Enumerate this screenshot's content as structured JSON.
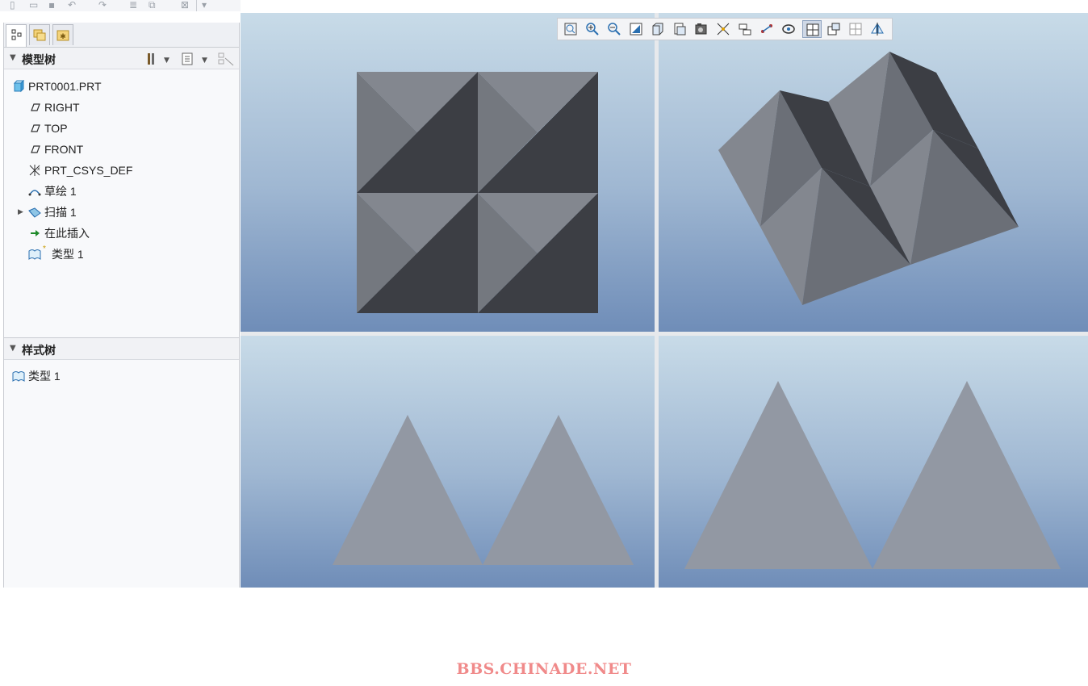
{
  "quick_access": {
    "icons": [
      "new-icon",
      "open-icon",
      "save-icon",
      "undo-icon",
      "redo-icon",
      "regenerate-icon",
      "windows-icon",
      "close-window-icon",
      "customize-icon"
    ]
  },
  "panel": {
    "tabs": [
      {
        "name": "model-tree-tab",
        "active": true
      },
      {
        "name": "folder-browser-tab",
        "active": false
      },
      {
        "name": "favorites-tab",
        "active": false
      }
    ],
    "model_tree": {
      "title": "模型树",
      "items": [
        {
          "label": "PRT0001.PRT",
          "icon": "part-icon"
        },
        {
          "label": "RIGHT",
          "icon": "datum-plane-icon"
        },
        {
          "label": "TOP",
          "icon": "datum-plane-icon"
        },
        {
          "label": "FRONT",
          "icon": "datum-plane-icon"
        },
        {
          "label": "PRT_CSYS_DEF",
          "icon": "csys-icon"
        },
        {
          "label": "草绘 1",
          "icon": "sketch-icon"
        },
        {
          "label": "扫描 1",
          "icon": "sweep-icon"
        },
        {
          "label": "在此插入",
          "icon": "insert-here-arrow-icon"
        },
        {
          "label": "类型 1",
          "icon": "style-icon"
        }
      ]
    },
    "style_tree": {
      "title": "样式树",
      "items": [
        {
          "label": "类型 1",
          "icon": "style-icon"
        }
      ]
    }
  },
  "view_toolbar": {
    "icons": [
      "refit-icon",
      "zoom-in-icon",
      "zoom-out-icon",
      "repaint-icon",
      "display-style-icon",
      "saved-views-icon",
      "view-manager-icon",
      "datum-display-icon",
      "spin-center-icon",
      "annotation-display-icon",
      "perspective-icon",
      "four-views-icon",
      "active-view-icon",
      "single-view-icon",
      "flip-view-icon"
    ],
    "active": "four-views-icon"
  },
  "viewports": [
    "top-view",
    "isometric-view",
    "front-view",
    "side-view"
  ],
  "colors": {
    "shade_light": "#83878f",
    "shade_mid": "#6b6f77",
    "shade_dark": "#3c3e44",
    "silhouette": "#9298a3"
  },
  "watermark": "BBS.CHINADE.NET"
}
